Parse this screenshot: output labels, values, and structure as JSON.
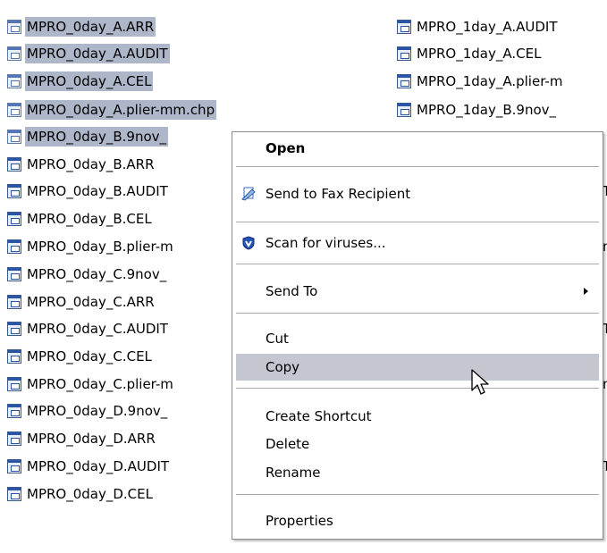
{
  "left_column": [
    {
      "name": "MPRO_0day_A.ARR",
      "selected": true
    },
    {
      "name": "MPRO_0day_A.AUDIT",
      "selected": true
    },
    {
      "name": "MPRO_0day_A.CEL",
      "selected": true
    },
    {
      "name": "MPRO_0day_A.plier-mm.chp",
      "selected": true
    },
    {
      "name": "MPRO_0day_B.9nov_",
      "selected": true
    },
    {
      "name": "MPRO_0day_B.ARR",
      "selected": false
    },
    {
      "name": "MPRO_0day_B.AUDIT",
      "selected": false
    },
    {
      "name": "MPRO_0day_B.CEL",
      "selected": false
    },
    {
      "name": "MPRO_0day_B.plier-m",
      "selected": false
    },
    {
      "name": "MPRO_0day_C.9nov_",
      "selected": false
    },
    {
      "name": "MPRO_0day_C.ARR",
      "selected": false
    },
    {
      "name": "MPRO_0day_C.AUDIT",
      "selected": false
    },
    {
      "name": "MPRO_0day_C.CEL",
      "selected": false
    },
    {
      "name": "MPRO_0day_C.plier-m",
      "selected": false
    },
    {
      "name": "MPRO_0day_D.9nov_",
      "selected": false
    },
    {
      "name": "MPRO_0day_D.ARR",
      "selected": false
    },
    {
      "name": "MPRO_0day_D.AUDIT",
      "selected": false
    },
    {
      "name": "MPRO_0day_D.CEL",
      "selected": false
    }
  ],
  "right_column": [
    {
      "name": "MPRO_1day_A.AUDIT"
    },
    {
      "name": "MPRO_1day_A.CEL"
    },
    {
      "name": "MPRO_1day_A.plier-m"
    },
    {
      "name": "MPRO_1day_B.9nov_"
    }
  ],
  "right_edge_fragments": [
    "T",
    "n",
    "T",
    "n",
    "T"
  ],
  "context_menu": {
    "open": "Open",
    "fax": "Send to Fax Recipient",
    "scan": "Scan for viruses...",
    "send_to": "Send To",
    "cut": "Cut",
    "copy": "Copy",
    "create_shortcut": "Create Shortcut",
    "delete": "Delete",
    "rename": "Rename",
    "properties": "Properties"
  },
  "colors": {
    "selection": "#aeb6c9",
    "menu_highlight": "#c5c7d0"
  }
}
